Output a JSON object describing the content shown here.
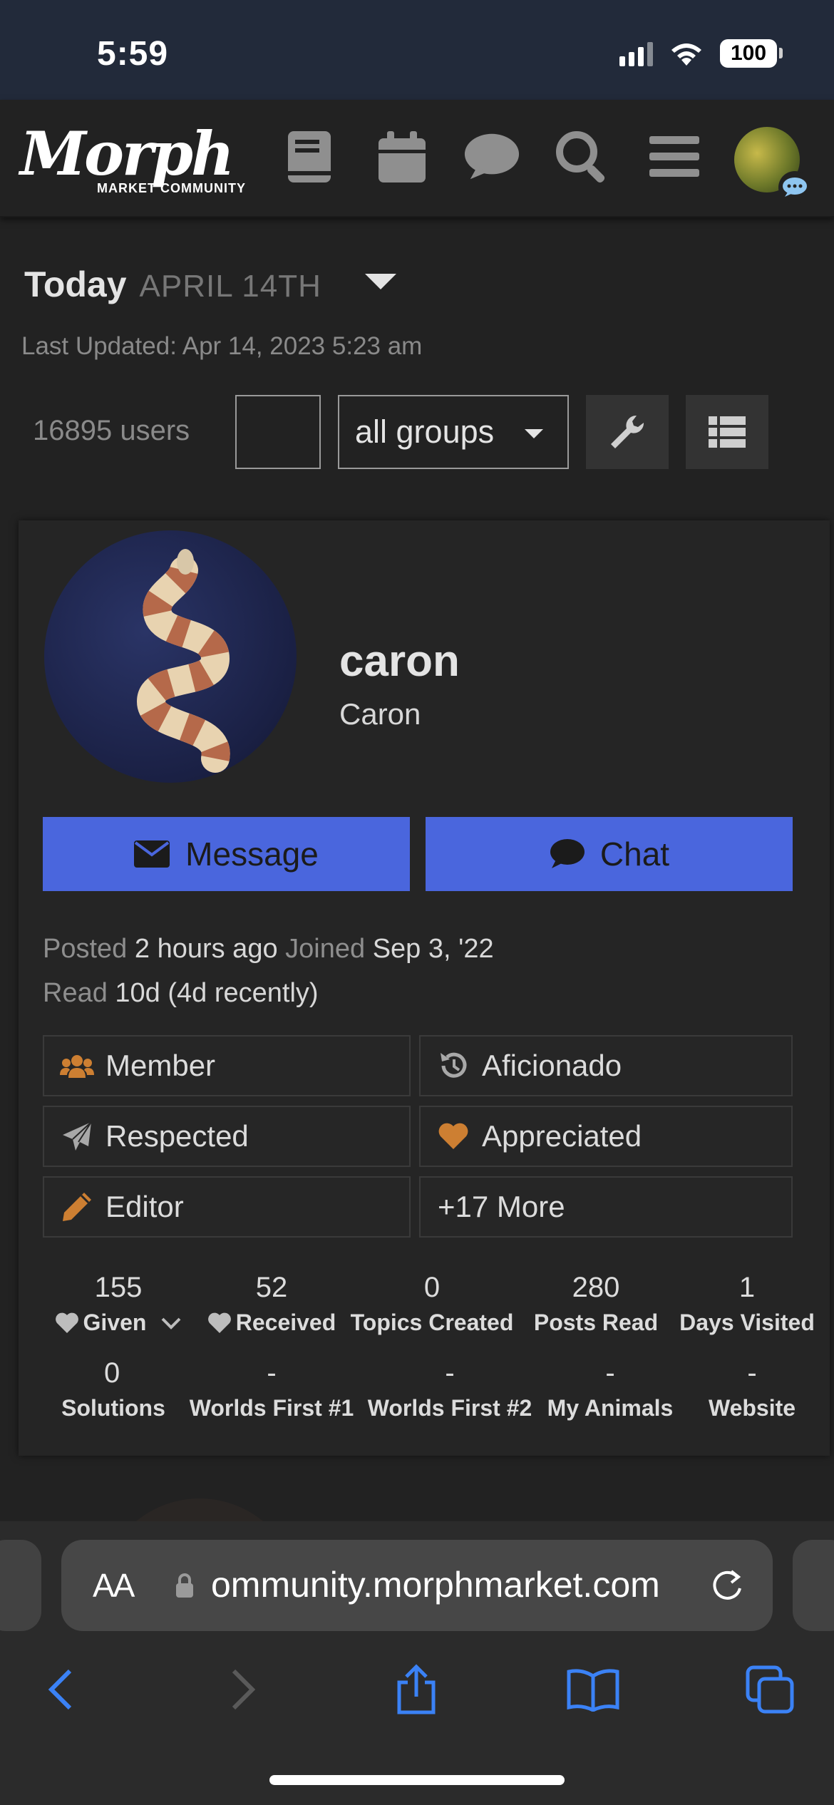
{
  "status_bar": {
    "time": "5:59",
    "battery": "100"
  },
  "header": {
    "logo_main": "Morph",
    "logo_sub": "MARKET COMMUNITY",
    "icons": [
      "book-icon",
      "calendar-icon",
      "chat-bubble-icon",
      "search-icon",
      "hamburger-menu-icon"
    ]
  },
  "directory": {
    "today_label": "Today",
    "today_date": "APRIL 14TH",
    "last_updated": "Last Updated: Apr 14, 2023 5:23 am",
    "users_count": "16895 users",
    "groups_select": "all groups"
  },
  "user": {
    "username": "caron",
    "name": "Caron",
    "message_label": "Message",
    "chat_label": "Chat",
    "posted_label": "Posted",
    "posted_value": "2 hours ago",
    "joined_label": "Joined",
    "joined_value": "Sep 3, '22",
    "read_label": "Read",
    "read_value": "10d (4d recently)",
    "badges": [
      {
        "label": "Member",
        "icon": "users-icon"
      },
      {
        "label": "Aficionado",
        "icon": "history-icon"
      },
      {
        "label": "Respected",
        "icon": "paper-plane-icon"
      },
      {
        "label": "Appreciated",
        "icon": "heart-icon"
      },
      {
        "label": "Editor",
        "icon": "pencil-icon"
      },
      {
        "label": "+17 More",
        "icon": ""
      }
    ],
    "stats": [
      {
        "value": "155",
        "label": "Given"
      },
      {
        "value": "52",
        "label": "Received"
      },
      {
        "value": "0",
        "label": "Topics Created"
      },
      {
        "value": "280",
        "label": "Posts Read"
      },
      {
        "value": "1",
        "label": "Days Visited"
      },
      {
        "value": "0",
        "label": "Solutions"
      },
      {
        "value": "-",
        "label": "Worlds First #1"
      },
      {
        "value": "-",
        "label": "Worlds First #2"
      },
      {
        "value": "-",
        "label": "My Animals"
      },
      {
        "value": "-",
        "label": "Website"
      }
    ]
  },
  "browser": {
    "text_size": "AA",
    "url": "ommunity.morphmarket.com"
  },
  "colors": {
    "accent_blue": "#4a66dd",
    "badge_bronze": "#cd7f32",
    "safari_blue": "#3b82f6"
  }
}
